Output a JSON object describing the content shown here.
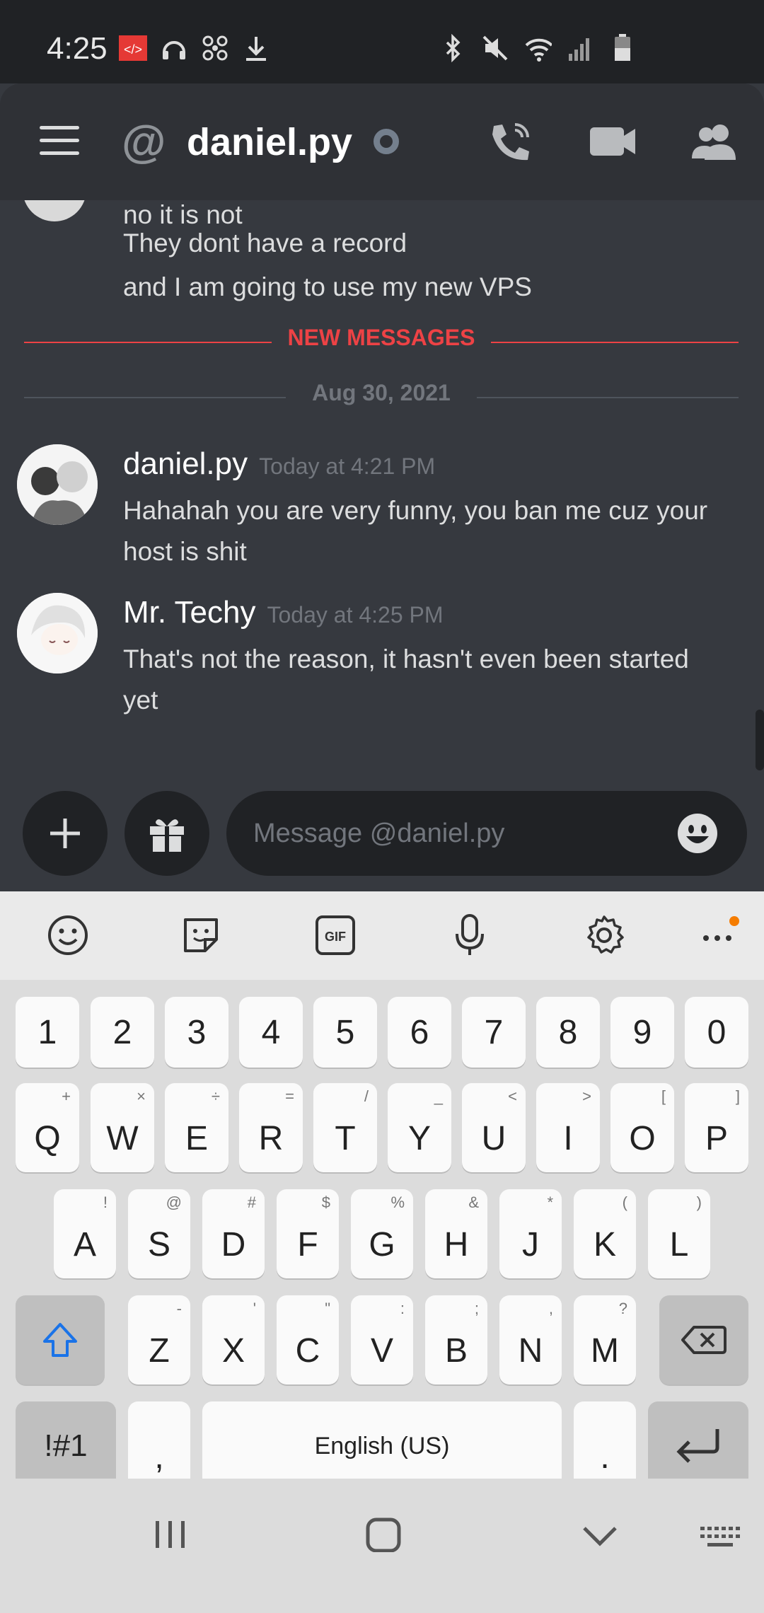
{
  "status_bar": {
    "time": "4:25"
  },
  "header": {
    "title": "daniel.py",
    "at_symbol": "@"
  },
  "messages": {
    "previous_lines": [
      "no it is not",
      "They dont have a record",
      "and I am going to use my new VPS"
    ],
    "new_messages_label": "NEW MESSAGES",
    "date_label": "Aug 30, 2021",
    "items": [
      {
        "author": "daniel.py",
        "timestamp": "Today at 4:21 PM",
        "lines": [
          "Hahahah you are very funny, you ban me cuz your",
          "host is shit"
        ]
      },
      {
        "author": "Mr. Techy",
        "timestamp": "Today at 4:25 PM",
        "lines": [
          "That's not the reason, it hasn't even been started",
          "yet"
        ]
      }
    ]
  },
  "composer": {
    "placeholder": "Message @daniel.py"
  },
  "keyboard": {
    "numbers": [
      "1",
      "2",
      "3",
      "4",
      "5",
      "6",
      "7",
      "8",
      "9",
      "0"
    ],
    "row1": [
      {
        "key": "Q",
        "hint": "+"
      },
      {
        "key": "W",
        "hint": "×"
      },
      {
        "key": "E",
        "hint": "÷"
      },
      {
        "key": "R",
        "hint": "="
      },
      {
        "key": "T",
        "hint": "/"
      },
      {
        "key": "Y",
        "hint": "_"
      },
      {
        "key": "U",
        "hint": "<"
      },
      {
        "key": "I",
        "hint": ">"
      },
      {
        "key": "O",
        "hint": "["
      },
      {
        "key": "P",
        "hint": "]"
      }
    ],
    "row2": [
      {
        "key": "A",
        "hint": "!"
      },
      {
        "key": "S",
        "hint": "@"
      },
      {
        "key": "D",
        "hint": "#"
      },
      {
        "key": "F",
        "hint": "$"
      },
      {
        "key": "G",
        "hint": "%"
      },
      {
        "key": "H",
        "hint": "&"
      },
      {
        "key": "J",
        "hint": "*"
      },
      {
        "key": "K",
        "hint": "("
      },
      {
        "key": "L",
        "hint": ")"
      }
    ],
    "row3": [
      {
        "key": "Z",
        "hint": "-"
      },
      {
        "key": "X",
        "hint": "'"
      },
      {
        "key": "C",
        "hint": "\""
      },
      {
        "key": "V",
        "hint": ":"
      },
      {
        "key": "B",
        "hint": ";"
      },
      {
        "key": "N",
        "hint": ","
      },
      {
        "key": "M",
        "hint": "?"
      }
    ],
    "symbols_label": "!#1",
    "comma_label": ",",
    "space_label": "English (US)",
    "period_label": "."
  },
  "colors": {
    "accent_red": "#ed4245",
    "muted": "#72767d",
    "shift_blue": "#1a73e8",
    "notify_dot": "#f57c00"
  }
}
